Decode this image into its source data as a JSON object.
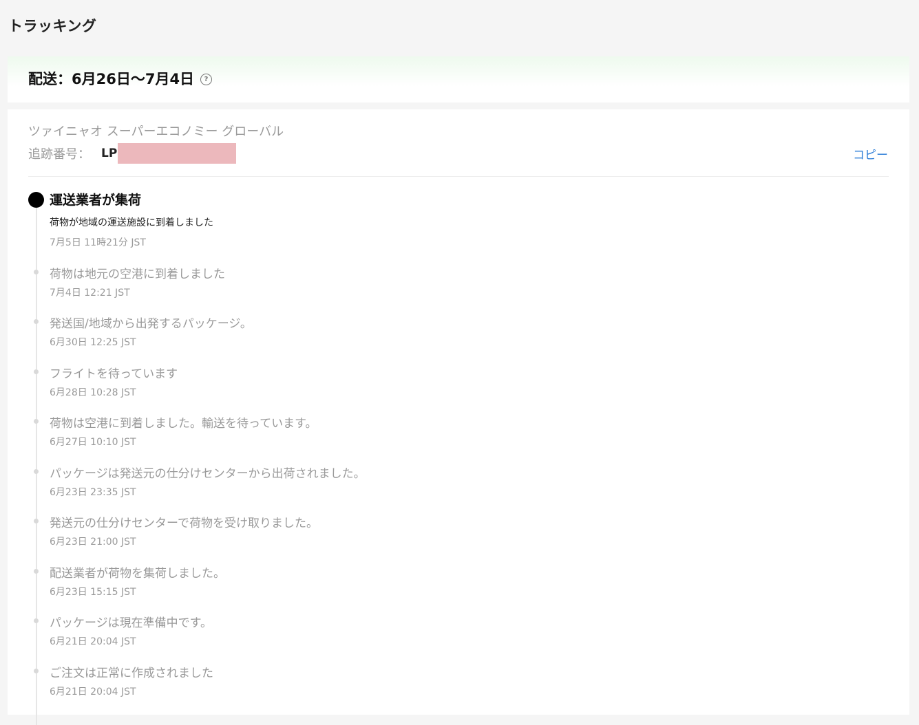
{
  "page": {
    "title": "トラッキング"
  },
  "delivery": {
    "label": "配送：6月26日〜7月4日",
    "help_icon": "question-circle-icon"
  },
  "carrier": {
    "name": "ツァイニャオ スーパーエコノミー グローバル",
    "tracking_label": "追跡番号：",
    "tracking_prefix": "LP",
    "copy_label": "コピー"
  },
  "latest": {
    "heading": "運送業者が集荷",
    "status": "荷物が地域の運送施設に到着しました",
    "time": "7月5日 11時21分 JST"
  },
  "events": [
    {
      "status": "荷物は地元の空港に到着しました",
      "time": "7月4日 12:21 JST"
    },
    {
      "status": "発送国/地域から出発するパッケージ。",
      "time": "6月30日 12:25 JST"
    },
    {
      "status": "フライトを待っています",
      "time": "6月28日 10:28 JST"
    },
    {
      "status": "荷物は空港に到着しました。輸送を待っています。",
      "time": "6月27日 10:10 JST"
    },
    {
      "status": "パッケージは発送元の仕分けセンターから出荷されました。",
      "time": "6月23日 23:35 JST"
    },
    {
      "status": "発送元の仕分けセンターで荷物を受け取りました。",
      "time": "6月23日 21:00 JST"
    },
    {
      "status": "配送業者が荷物を集荷しました。",
      "time": "6月23日 15:15 JST"
    },
    {
      "status": "パッケージは現在準備中です。",
      "time": "6月21日 20:04 JST"
    },
    {
      "status": "ご注文は正常に作成されました",
      "time": "6月21日 20:04 JST"
    }
  ],
  "colors": {
    "link": "#2f7fd8",
    "muted_text": "#9a9a9a",
    "redaction": "#ecb8bc",
    "active_dot": "#000000",
    "inactive_dot": "#d9d9d9"
  }
}
